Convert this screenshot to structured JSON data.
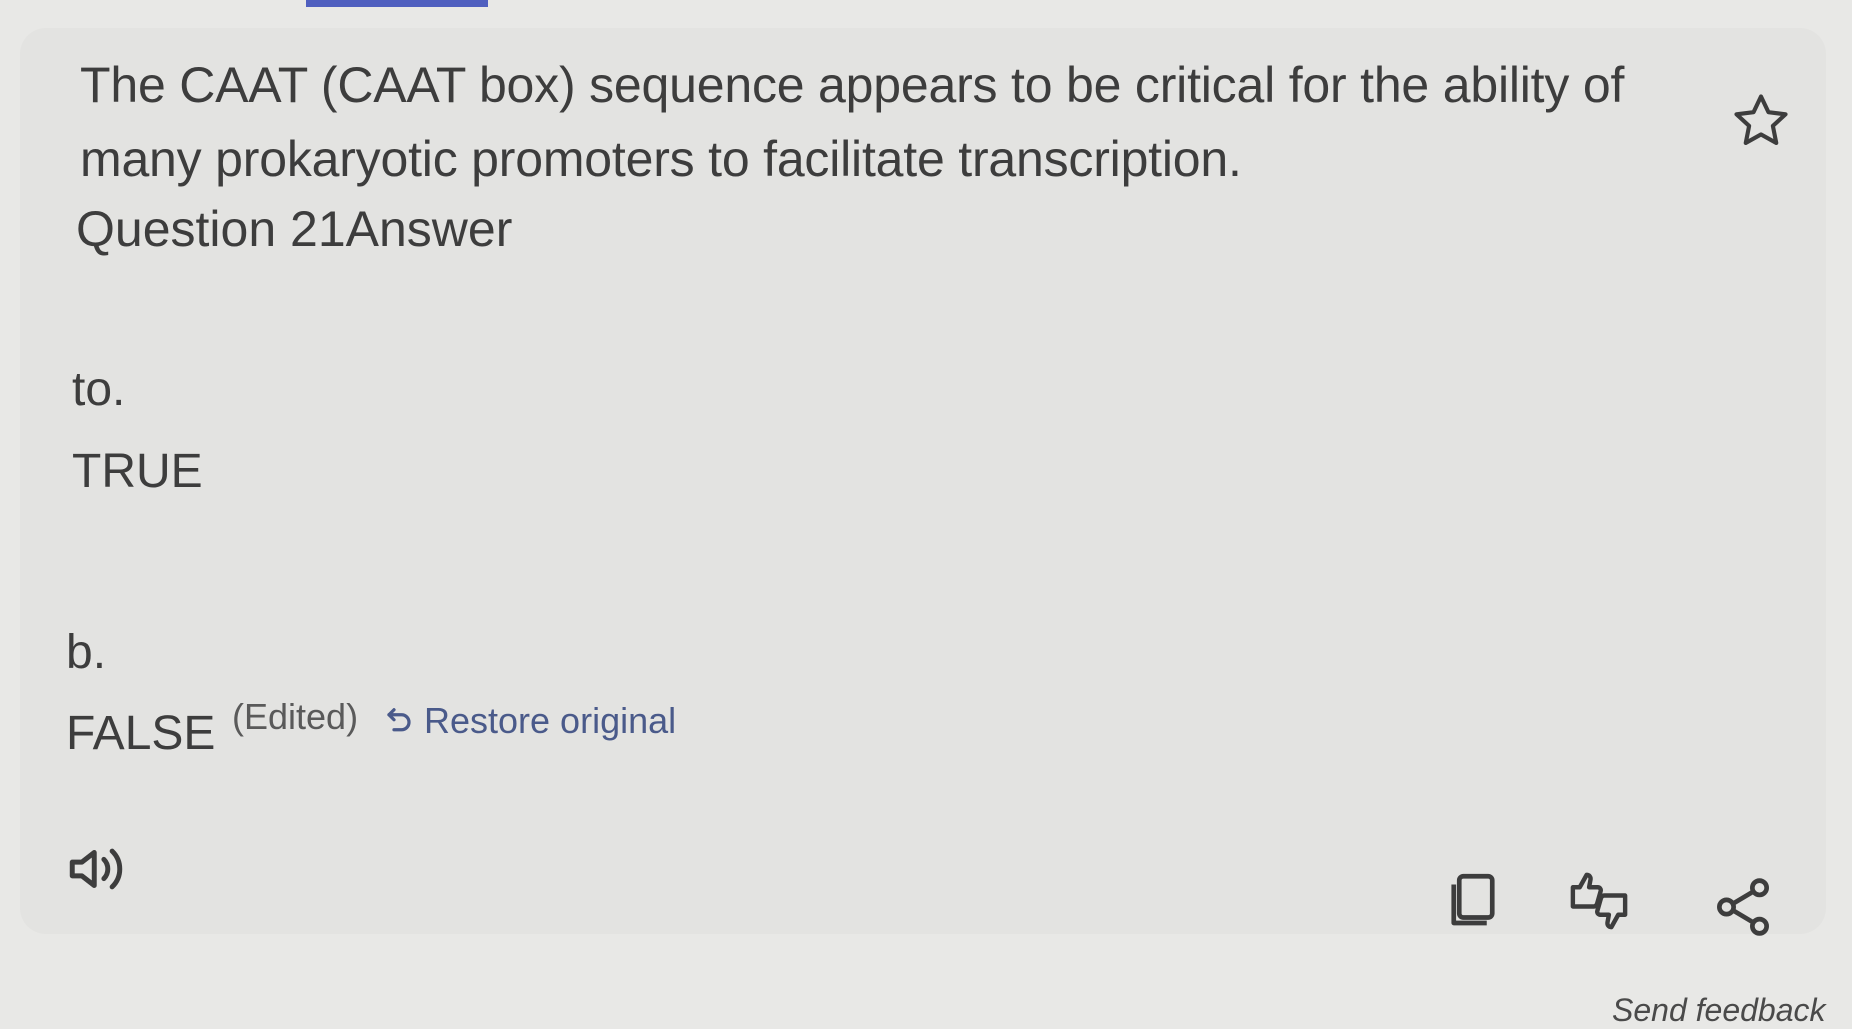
{
  "question": {
    "text": "The CAAT (CAAT box) sequence appears to be critical for the ability of many prokaryotic promoters to facilitate transcription.",
    "label": "Question 21Answer"
  },
  "options": [
    {
      "letter": "to.",
      "text": "TRUE"
    },
    {
      "letter": "b.",
      "text": "FALSE"
    }
  ],
  "edit": {
    "edited_label": "(Edited)",
    "restore_label": "Restore original"
  },
  "footer": {
    "feedback_label": "Send feedback"
  },
  "icons": {
    "star": "star-icon",
    "speaker": "speaker-icon",
    "copy": "copy-icon",
    "rate": "thumbs-up-down-icon",
    "share": "share-icon",
    "restore": "undo-icon"
  },
  "colors": {
    "accent": "#4f5fbf",
    "link": "#4a5a8a"
  }
}
